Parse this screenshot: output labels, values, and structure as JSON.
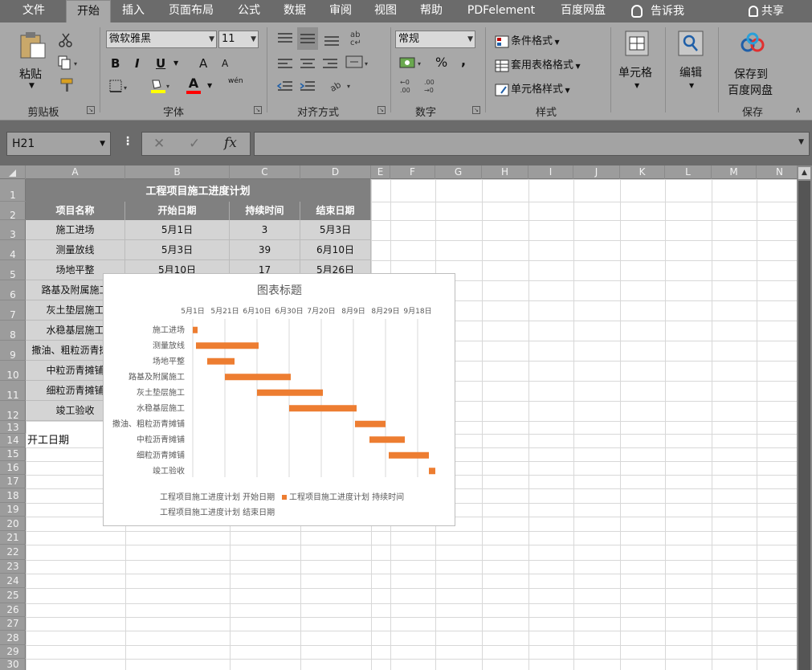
{
  "tabs": [
    "文件",
    "开始",
    "插入",
    "页面布局",
    "公式",
    "数据",
    "审阅",
    "视图",
    "帮助",
    "PDFelement",
    "百度网盘"
  ],
  "active_tab": "开始",
  "tell_me": "告诉我",
  "share": "共享",
  "ribbon": {
    "clipboard": {
      "paste": "粘贴",
      "label": "剪贴板"
    },
    "font": {
      "name": "微软雅黑",
      "size": "11",
      "bold": "B",
      "italic": "I",
      "underline": "U",
      "grow": "A",
      "shrink": "A",
      "font_color": "A",
      "phonetic": "wén",
      "label": "字体"
    },
    "alignment": {
      "label": "对齐方式"
    },
    "number": {
      "format": "常规",
      "percent": "%",
      "comma": ",",
      "label": "数字"
    },
    "styles": {
      "conditional": "条件格式",
      "table": "套用表格格式",
      "cell_style": "单元格样式",
      "label": "样式"
    },
    "cells": {
      "label": "单元格"
    },
    "editing": {
      "label": "编辑"
    },
    "save": {
      "line1": "保存到",
      "line2": "百度网盘",
      "label": "保存"
    }
  },
  "name_box": "H21",
  "columns": [
    "A",
    "B",
    "C",
    "D",
    "E",
    "F",
    "G",
    "H",
    "I",
    "J",
    "K",
    "L",
    "M",
    "N"
  ],
  "rows": [
    "1",
    "2",
    "3",
    "4",
    "5",
    "6",
    "7",
    "8",
    "9",
    "10",
    "11",
    "12",
    "13",
    "14",
    "15",
    "16",
    "17",
    "18",
    "19",
    "20",
    "21",
    "22",
    "23",
    "24",
    "25",
    "26",
    "27",
    "28",
    "29",
    "30"
  ],
  "table": {
    "title": "工程项目施工进度计划",
    "headers": [
      "项目名称",
      "开始日期",
      "持续时间",
      "结束日期"
    ],
    "rows": [
      [
        "施工进场",
        "5月1日",
        "3",
        "5月3日"
      ],
      [
        "测量放线",
        "5月3日",
        "39",
        "6月10日"
      ],
      [
        "场地平整",
        "5月10日",
        "17",
        "5月26日"
      ],
      [
        "路基及附属施工",
        "",
        "",
        ""
      ],
      [
        "灰土垫层施工",
        "",
        "",
        ""
      ],
      [
        "水稳基层施工",
        "",
        "",
        ""
      ],
      [
        "撒油、粗粒沥青摊铺",
        "",
        "",
        ""
      ],
      [
        "中粒沥青摊铺",
        "",
        "",
        ""
      ],
      [
        "细粒沥青摊铺",
        "",
        "",
        ""
      ],
      [
        "竣工验收",
        "",
        "",
        ""
      ]
    ],
    "a14": "开工日期"
  },
  "chart_data": {
    "type": "bar",
    "title": "图表标题",
    "orientation": "horizontal-gantt",
    "x_ticks": [
      "5月1日",
      "5月21日",
      "6月10日",
      "6月30日",
      "7月20日",
      "8月9日",
      "8月29日",
      "9月18日"
    ],
    "xlim_days": [
      0,
      150
    ],
    "categories": [
      "施工进场",
      "测量放线",
      "场地平整",
      "路基及附属施工",
      "灰土垫层施工",
      "水稳基层施工",
      "撒油、粗粒沥青摊铺",
      "中粒沥青摊铺",
      "细粒沥青摊铺",
      "竣工验收"
    ],
    "series": [
      {
        "name": "工程项目施工进度计划 开始日期",
        "values": [
          0,
          2,
          9,
          20,
          40,
          60,
          101,
          110,
          122,
          147
        ],
        "visible": false
      },
      {
        "name": "工程项目施工进度计划 持续时间",
        "values": [
          3,
          39,
          17,
          41,
          41,
          42,
          19,
          22,
          25,
          4
        ],
        "color": "#ED7D31"
      },
      {
        "name": "工程项目施工进度计划 结束日期",
        "values": [],
        "visible": false
      }
    ],
    "legend": [
      "工程项目施工进度计划 开始日期",
      "工程项目施工进度计划 持续时间",
      "工程项目施工进度计划 结束日期"
    ],
    "legend_position": "bottom",
    "grid": true
  }
}
